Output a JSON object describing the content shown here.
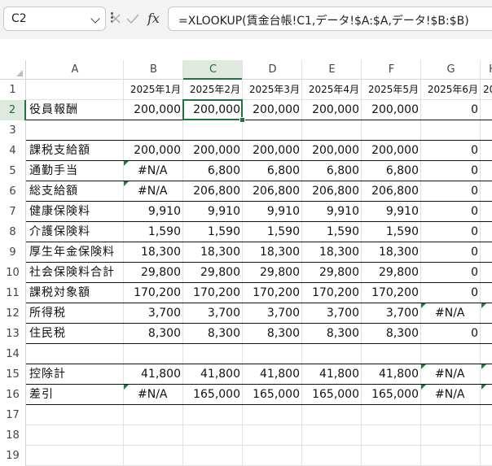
{
  "name_box": {
    "value": "C2"
  },
  "formula_bar": {
    "fx_label": "fx",
    "formula": "=XLOOKUP(賃金台帳!C1,データ!$A:$A,データ!$B:$B)"
  },
  "columns": [
    "A",
    "B",
    "C",
    "D",
    "E",
    "F",
    "G",
    "H"
  ],
  "selected_column": "C",
  "selected_row": "2",
  "rows": [
    "1",
    "2",
    "3",
    "4",
    "5",
    "6",
    "7",
    "8",
    "9",
    "10",
    "11",
    "12",
    "13",
    "14",
    "15",
    "16",
    "17",
    "18",
    "19"
  ],
  "sheet": {
    "header_row": [
      "",
      "2025年1月",
      "2025年2月",
      "2025年3月",
      "2025年4月",
      "2025年5月",
      "2025年6月",
      "20"
    ],
    "data_rows": [
      {
        "row": "2",
        "label": "役員報酬",
        "values": [
          "200,000",
          "200,000",
          "200,000",
          "200,000",
          "200,000",
          "0"
        ]
      },
      {
        "row": "3",
        "label": "",
        "values": [
          "",
          "",
          "",
          "",
          "",
          ""
        ]
      },
      {
        "row": "4",
        "label": "課税支給額",
        "values": [
          "200,000",
          "200,000",
          "200,000",
          "200,000",
          "200,000",
          "0"
        ]
      },
      {
        "row": "5",
        "label": "通勤手当",
        "values": [
          "#N/A",
          "6,800",
          "6,800",
          "6,800",
          "6,800",
          "0"
        ]
      },
      {
        "row": "6",
        "label": "総支給額",
        "values": [
          "#N/A",
          "206,800",
          "206,800",
          "206,800",
          "206,800",
          "0"
        ]
      },
      {
        "row": "7",
        "label": "健康保険料",
        "values": [
          "9,910",
          "9,910",
          "9,910",
          "9,910",
          "9,910",
          "0"
        ]
      },
      {
        "row": "8",
        "label": "介護保険料",
        "values": [
          "1,590",
          "1,590",
          "1,590",
          "1,590",
          "1,590",
          "0"
        ]
      },
      {
        "row": "9",
        "label": "厚生年金保険料",
        "values": [
          "18,300",
          "18,300",
          "18,300",
          "18,300",
          "18,300",
          "0"
        ]
      },
      {
        "row": "10",
        "label": "社会保険料合計",
        "values": [
          "29,800",
          "29,800",
          "29,800",
          "29,800",
          "29,800",
          "0"
        ]
      },
      {
        "row": "11",
        "label": "課税対象額",
        "values": [
          "170,200",
          "170,200",
          "170,200",
          "170,200",
          "170,200",
          "0"
        ]
      },
      {
        "row": "12",
        "label": "所得税",
        "values": [
          "3,700",
          "3,700",
          "3,700",
          "3,700",
          "3,700",
          "#N/A"
        ]
      },
      {
        "row": "13",
        "label": "住民税",
        "values": [
          "8,300",
          "8,300",
          "8,300",
          "8,300",
          "8,300",
          "0"
        ]
      },
      {
        "row": "14",
        "label": "",
        "values": [
          "",
          "",
          "",
          "",
          "",
          ""
        ]
      },
      {
        "row": "15",
        "label": "控除計",
        "values": [
          "41,800",
          "41,800",
          "41,800",
          "41,800",
          "41,800",
          "#N/A"
        ]
      },
      {
        "row": "16",
        "label": "差引",
        "values": [
          "#N/A",
          "165,000",
          "165,000",
          "165,000",
          "165,000",
          "#N/A"
        ]
      }
    ]
  },
  "colors": {
    "accent": "#217346",
    "error_triangle": "#1e7d3c"
  }
}
